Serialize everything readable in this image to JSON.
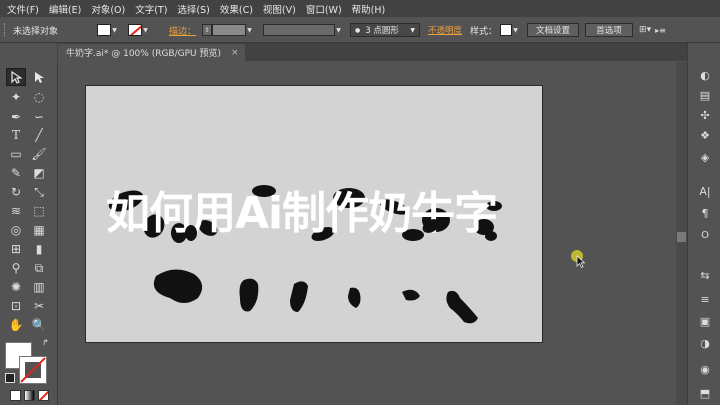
{
  "menubar": {
    "items": [
      "文件(F)",
      "编辑(E)",
      "对象(O)",
      "文字(T)",
      "选择(S)",
      "效果(C)",
      "视图(V)",
      "窗口(W)",
      "帮助(H)"
    ]
  },
  "control_bar": {
    "no_selection_label": "未选择对象",
    "stroke_label": "描边：",
    "brush_label": "3 点圆形",
    "opacity_label": "不透明度",
    "style_label": "样式：",
    "doc_setup_button": "文档设置",
    "preferences_button": "首选项"
  },
  "document_tab": {
    "title": "牛奶字.ai* @ 100% (RGB/GPU 预览)",
    "close": "×"
  },
  "artboard": {
    "headline": "如何用Ai制作奶牛字"
  },
  "colors": {
    "accent": "#f0a23a",
    "none_red": "#e0251b",
    "artboard": "#d3d3d3",
    "cursor_highlight": "#c9c22e"
  },
  "icons": {
    "tools": [
      "selection-tool",
      "direct-selection-tool",
      "magic-wand-tool",
      "lasso-tool",
      "pen-tool",
      "curvature-tool",
      "type-tool",
      "line-segment-tool",
      "rectangle-tool",
      "paintbrush-tool",
      "shaper-tool",
      "eraser-tool",
      "rotate-tool",
      "scale-tool",
      "width-tool",
      "free-transform-tool",
      "shape-builder-tool",
      "perspective-grid-tool",
      "mesh-tool",
      "gradient-tool",
      "eyedropper-tool",
      "blend-tool",
      "symbol-sprayer-tool",
      "column-graph-tool",
      "artboard-tool",
      "slice-tool",
      "hand-tool",
      "zoom-tool"
    ],
    "dock": [
      "color-icon",
      "color-guide-icon",
      "swatches-icon",
      "brushes-icon",
      "symbols-icon",
      "layers-icon",
      "artboards-icon",
      "character-icon",
      "paragraph-icon",
      "opentype-icon",
      "stroke-icon",
      "gradient-icon",
      "transparency-icon",
      "appearance-icon",
      "graphic-styles-icon"
    ]
  }
}
